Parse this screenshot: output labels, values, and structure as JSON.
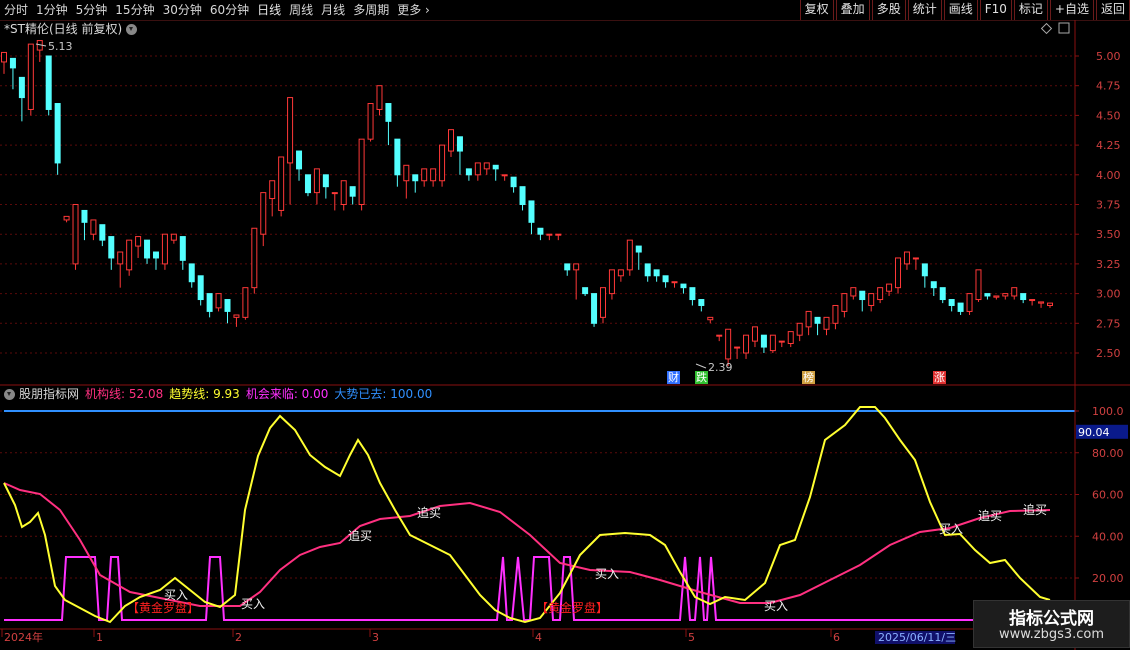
{
  "toolbar": {
    "periods": [
      "分时",
      "1分钟",
      "5分钟",
      "15分钟",
      "30分钟",
      "60分钟",
      "日线",
      "周线",
      "月线",
      "多周期",
      "更多"
    ],
    "active_period": "日线",
    "buttons": [
      "复权",
      "叠加",
      "多股",
      "统计",
      "画线",
      "F10",
      "标记",
      "+自选",
      "返回"
    ]
  },
  "title": "*ST精伦(日线 前复权)",
  "price_axis": [
    "5.00",
    "4.75",
    "4.50",
    "4.25",
    "4.00",
    "3.75",
    "3.50",
    "3.25",
    "3.00",
    "2.75",
    "2.50"
  ],
  "high_label": "5.13",
  "low_label": "2.39",
  "badges": [
    {
      "text": "财",
      "color": "#3070ff"
    },
    {
      "text": "跌",
      "color": "#30c030"
    },
    {
      "text": "榜",
      "color": "#d0a040"
    },
    {
      "text": "涨",
      "color": "#e03030"
    }
  ],
  "indicator": {
    "name": "股朋指标网",
    "items": [
      {
        "label": "机构线:",
        "value": "52.08",
        "color": "#ff3080"
      },
      {
        "label": "趋势线:",
        "value": "9.93",
        "color": "#ffff30"
      },
      {
        "label": "机会来临:",
        "value": "0.00",
        "color": "#ff30ff"
      },
      {
        "label": "大势已去:",
        "value": "100.00",
        "color": "#3090ff"
      }
    ]
  },
  "ind_axis": [
    "100.0",
    "80.00",
    "60.00",
    "40.00",
    "20.00"
  ],
  "ind_current": "90.04",
  "signals": {
    "buy": "买入",
    "chase": "追买",
    "golden": "【黄金罗盘】"
  },
  "time_axis": [
    "2024年",
    "1",
    "2",
    "3",
    "4",
    "5",
    "6"
  ],
  "cursor_date": "2025/06/11/三",
  "watermark": {
    "title": "指标公式网",
    "url": "www.zbgs3.com"
  },
  "colors": {
    "up": "#ff3838",
    "down": "#54ffff",
    "grid": "#5a0a0a",
    "axis": "#8a1010"
  },
  "chart_data": {
    "type": "candlestick",
    "candles": [
      [
        4.95,
        5.03,
        4.85,
        4.98
      ],
      [
        4.98,
        4.9,
        4.72,
        4.82
      ],
      [
        4.82,
        4.65,
        4.45,
        4.55
      ],
      [
        4.55,
        5.1,
        4.5,
        5.05
      ],
      [
        5.05,
        5.13,
        4.95,
        5.0
      ],
      [
        5.0,
        4.55,
        4.5,
        4.6
      ],
      [
        4.6,
        4.1,
        4.0,
        4.05
      ],
      [
        3.62,
        3.65,
        3.6,
        3.62
      ],
      [
        3.25,
        3.75,
        3.2,
        3.7
      ],
      [
        3.7,
        3.6,
        3.45,
        3.5
      ],
      [
        3.5,
        3.62,
        3.45,
        3.58
      ],
      [
        3.58,
        3.45,
        3.4,
        3.48
      ],
      [
        3.48,
        3.3,
        3.2,
        3.25
      ],
      [
        3.25,
        3.35,
        3.05,
        3.2
      ],
      [
        3.2,
        3.45,
        3.15,
        3.4
      ],
      [
        3.4,
        3.48,
        3.3,
        3.45
      ],
      [
        3.45,
        3.3,
        3.25,
        3.35
      ],
      [
        3.35,
        3.3,
        3.2,
        3.25
      ],
      [
        3.25,
        3.5,
        3.2,
        3.45
      ],
      [
        3.45,
        3.5,
        3.42,
        3.48
      ],
      [
        3.48,
        3.28,
        3.2,
        3.25
      ],
      [
        3.25,
        3.1,
        3.05,
        3.15
      ],
      [
        3.15,
        2.95,
        2.9,
        3.0
      ],
      [
        3.0,
        2.85,
        2.8,
        2.88
      ],
      [
        2.88,
        3.0,
        2.85,
        2.95
      ],
      [
        2.95,
        2.85,
        2.75,
        2.8
      ],
      [
        2.8,
        2.82,
        2.72,
        2.78
      ],
      [
        2.8,
        3.05,
        2.78,
        3.0
      ],
      [
        3.05,
        3.55,
        3.0,
        3.5
      ],
      [
        3.5,
        3.85,
        3.4,
        3.8
      ],
      [
        3.8,
        3.95,
        3.65,
        3.7
      ],
      [
        3.7,
        4.15,
        3.65,
        4.1
      ],
      [
        4.1,
        4.65,
        3.75,
        4.2
      ],
      [
        4.2,
        4.05,
        3.95,
        4.0
      ],
      [
        4.0,
        3.85,
        3.82,
        3.85
      ],
      [
        3.85,
        4.05,
        3.75,
        4.0
      ],
      [
        4.0,
        3.9,
        3.8,
        3.85
      ],
      [
        3.85,
        3.85,
        3.7,
        3.8
      ],
      [
        3.75,
        3.95,
        3.7,
        3.9
      ],
      [
        3.9,
        3.82,
        3.75,
        3.8
      ],
      [
        3.75,
        4.3,
        3.7,
        4.25
      ],
      [
        4.3,
        4.6,
        4.28,
        4.55
      ],
      [
        4.55,
        4.75,
        4.5,
        4.6
      ],
      [
        4.6,
        4.45,
        4.25,
        4.3
      ],
      [
        4.3,
        4.0,
        3.9,
        4.05
      ],
      [
        3.95,
        4.08,
        3.8,
        4.02
      ],
      [
        4.0,
        3.95,
        3.85,
        3.95
      ],
      [
        3.95,
        4.05,
        3.9,
        4.0
      ],
      [
        3.95,
        4.05,
        3.9,
        4.0
      ],
      [
        3.95,
        4.25,
        3.9,
        4.2
      ],
      [
        4.2,
        4.38,
        4.15,
        4.32
      ],
      [
        4.32,
        4.2,
        4.0,
        4.05
      ],
      [
        4.05,
        4.0,
        3.95,
        4.0
      ],
      [
        4.0,
        4.1,
        3.95,
        4.05
      ],
      [
        4.05,
        4.1,
        4.0,
        4.08
      ],
      [
        4.08,
        4.05,
        3.95,
        4.0
      ],
      [
        4.0,
        4.0,
        3.95,
        3.98
      ],
      [
        3.98,
        3.9,
        3.85,
        3.9
      ],
      [
        3.9,
        3.75,
        3.7,
        3.78
      ],
      [
        3.78,
        3.6,
        3.5,
        3.55
      ],
      [
        3.55,
        3.5,
        3.45,
        3.5
      ],
      [
        3.5,
        3.5,
        3.45,
        3.5
      ],
      [
        3.5,
        3.5,
        3.45,
        3.5
      ],
      [
        3.25,
        3.2,
        3.15,
        3.2
      ],
      [
        3.2,
        3.25,
        2.95,
        3.05
      ],
      [
        3.05,
        3.0,
        2.98,
        3.0
      ],
      [
        3.0,
        2.75,
        2.72,
        2.8
      ],
      [
        2.8,
        3.05,
        2.75,
        3.0
      ],
      [
        3.0,
        3.2,
        2.95,
        3.15
      ],
      [
        3.15,
        3.2,
        3.1,
        3.2
      ],
      [
        3.2,
        3.45,
        3.15,
        3.4
      ],
      [
        3.4,
        3.35,
        3.2,
        3.25
      ],
      [
        3.25,
        3.15,
        3.1,
        3.2
      ],
      [
        3.2,
        3.15,
        3.1,
        3.15
      ],
      [
        3.15,
        3.1,
        3.05,
        3.1
      ],
      [
        3.1,
        3.1,
        3.05,
        3.08
      ],
      [
        3.08,
        3.05,
        3.0,
        3.05
      ],
      [
        3.05,
        2.95,
        2.9,
        2.95
      ],
      [
        2.95,
        2.9,
        2.85,
        2.9
      ],
      [
        2.78,
        2.8,
        2.75,
        2.78
      ],
      [
        2.65,
        2.65,
        2.6,
        2.62
      ],
      [
        2.45,
        2.7,
        2.39,
        2.55
      ],
      [
        2.55,
        2.55,
        2.45,
        2.5
      ],
      [
        2.5,
        2.65,
        2.45,
        2.6
      ],
      [
        2.6,
        2.72,
        2.55,
        2.65
      ],
      [
        2.65,
        2.55,
        2.5,
        2.52
      ],
      [
        2.52,
        2.65,
        2.5,
        2.6
      ],
      [
        2.6,
        2.6,
        2.55,
        2.58
      ],
      [
        2.58,
        2.68,
        2.55,
        2.65
      ],
      [
        2.65,
        2.75,
        2.6,
        2.72
      ],
      [
        2.72,
        2.85,
        2.65,
        2.8
      ],
      [
        2.8,
        2.75,
        2.65,
        2.7
      ],
      [
        2.7,
        2.8,
        2.65,
        2.75
      ],
      [
        2.75,
        2.9,
        2.7,
        2.85
      ],
      [
        2.85,
        3.0,
        2.8,
        2.98
      ],
      [
        2.98,
        3.05,
        2.95,
        3.02
      ],
      [
        3.02,
        2.95,
        2.85,
        2.9
      ],
      [
        2.9,
        3.0,
        2.85,
        2.95
      ],
      [
        2.95,
        3.05,
        2.92,
        3.02
      ],
      [
        3.02,
        3.08,
        2.98,
        3.05
      ],
      [
        3.05,
        3.3,
        3.0,
        3.25
      ],
      [
        3.25,
        3.35,
        3.2,
        3.3
      ],
      [
        3.3,
        3.3,
        3.2,
        3.25
      ],
      [
        3.25,
        3.15,
        3.05,
        3.1
      ],
      [
        3.1,
        3.05,
        2.98,
        3.05
      ],
      [
        3.05,
        2.95,
        2.92,
        2.95
      ],
      [
        2.95,
        2.9,
        2.85,
        2.92
      ],
      [
        2.92,
        2.85,
        2.82,
        2.85
      ],
      [
        2.85,
        3.0,
        2.82,
        2.95
      ],
      [
        2.95,
        3.2,
        2.93,
        3.0
      ],
      [
        3.0,
        2.98,
        2.95,
        2.97
      ],
      [
        2.97,
        2.98,
        2.95,
        2.98
      ],
      [
        2.98,
        3.0,
        2.95,
        2.98
      ],
      [
        2.98,
        3.05,
        2.95,
        3.0
      ],
      [
        3.0,
        2.95,
        2.92,
        2.95
      ],
      [
        2.95,
        2.95,
        2.9,
        2.92
      ],
      [
        2.92,
        2.93,
        2.88,
        2.9
      ],
      [
        2.9,
        2.92,
        2.88,
        2.9
      ]
    ]
  }
}
